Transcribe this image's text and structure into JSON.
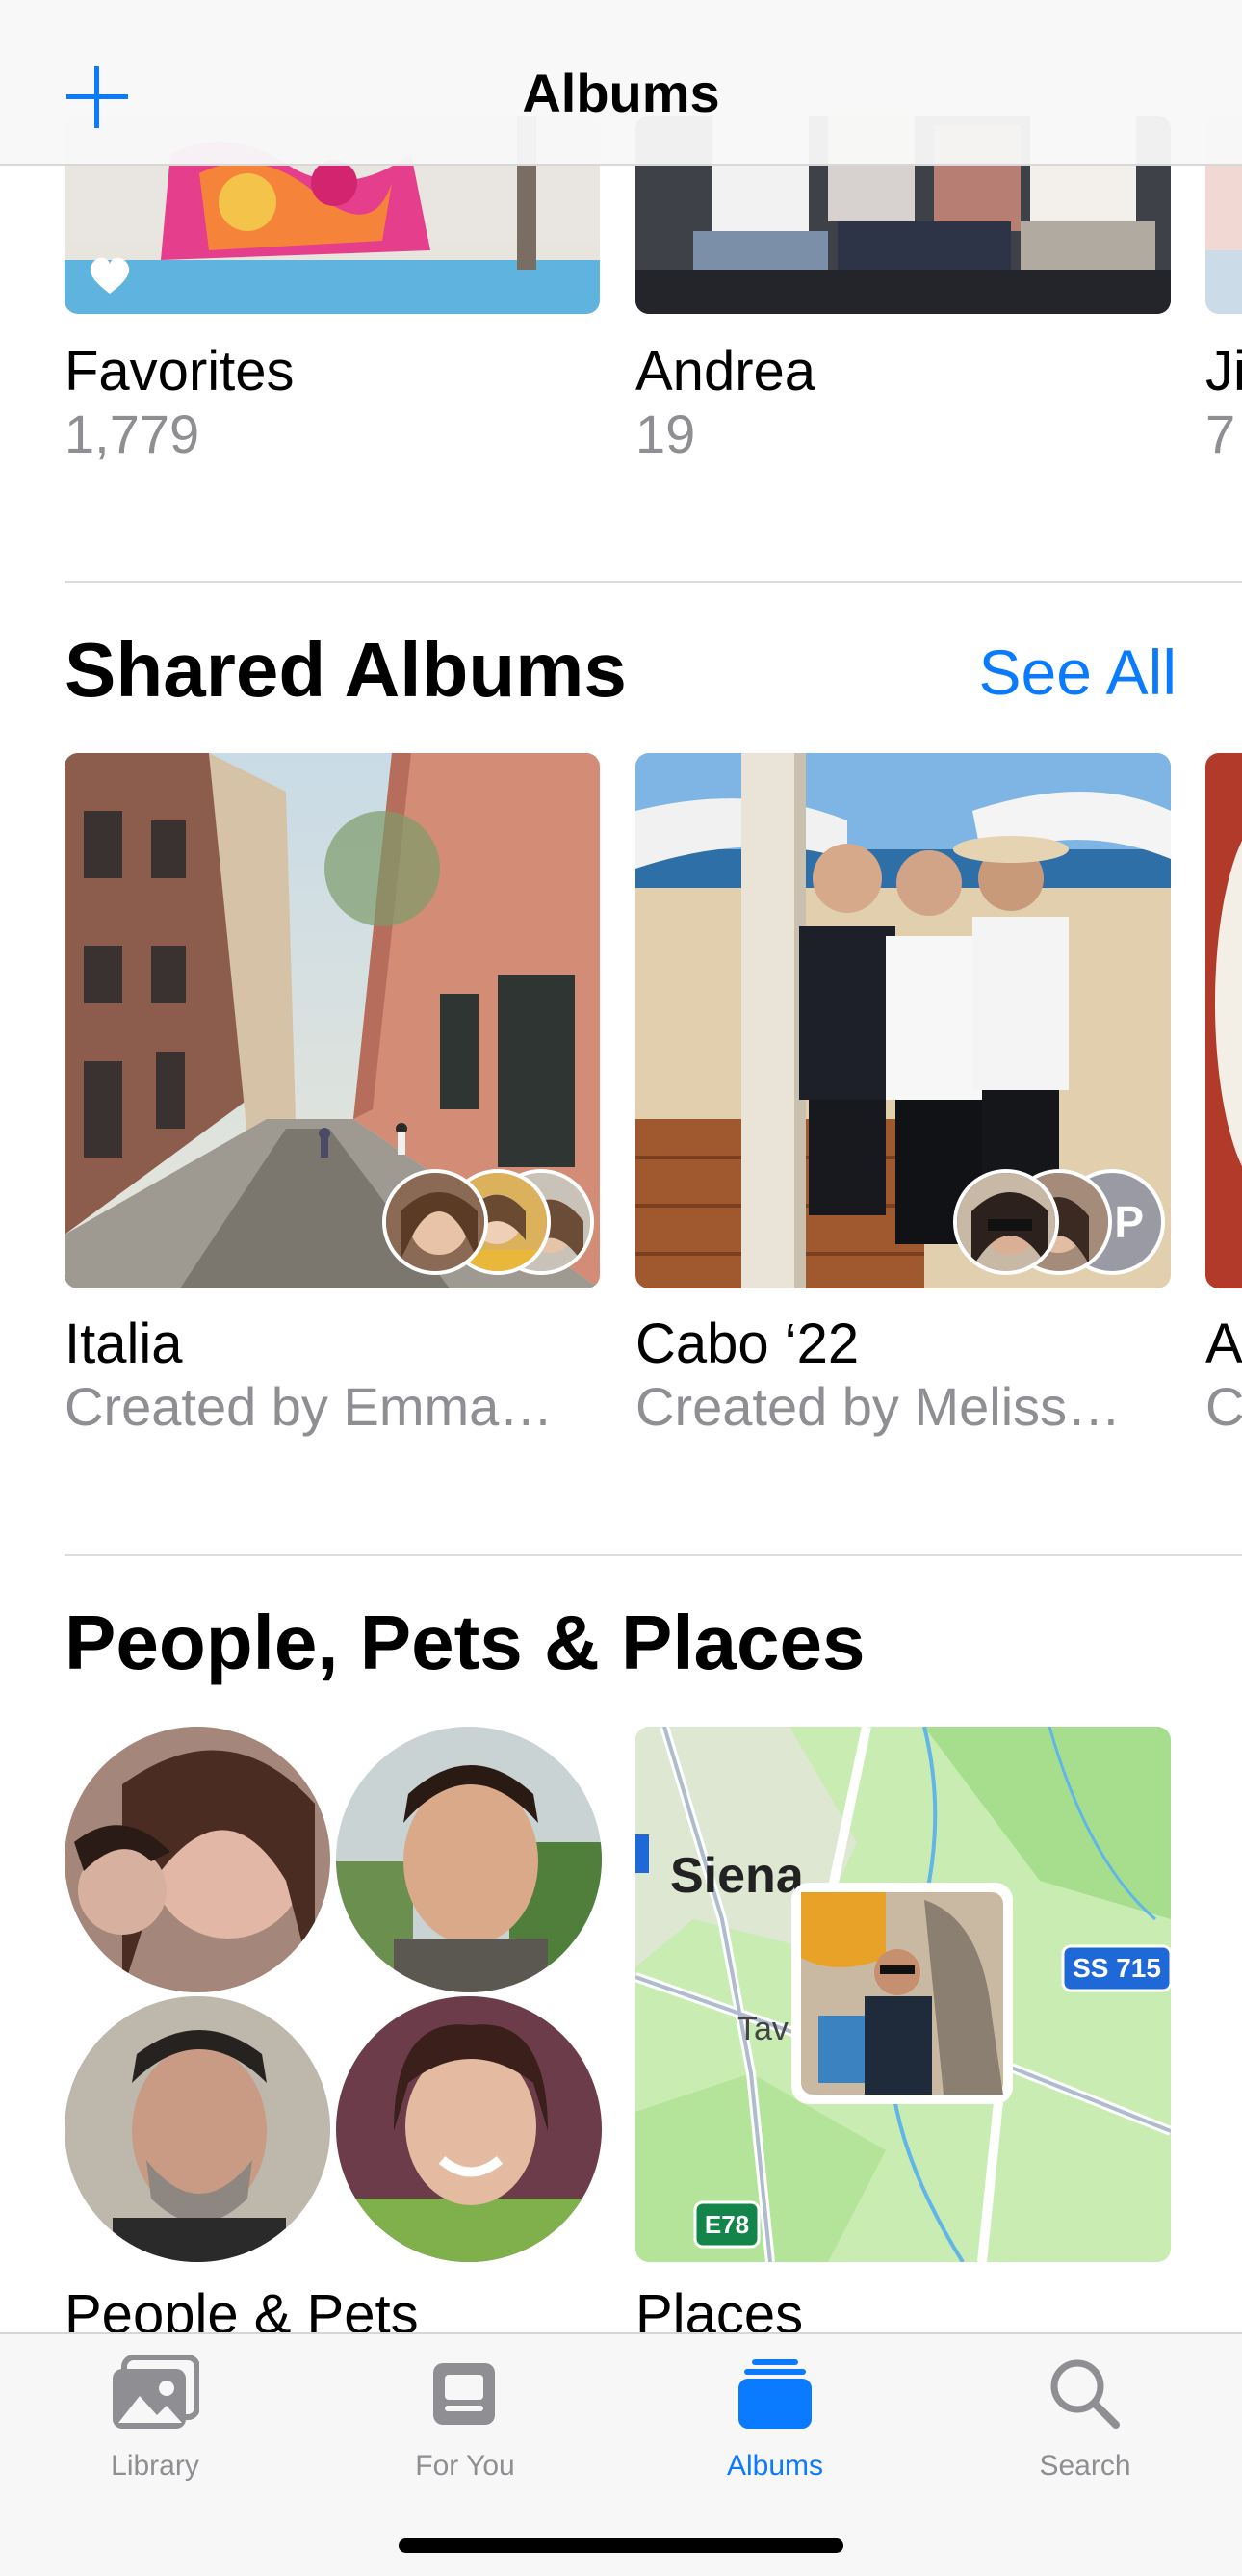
{
  "header": {
    "title": "Albums",
    "add_icon": "plus-icon"
  },
  "my_albums": [
    {
      "title": "Favorites",
      "count": "1,779"
    },
    {
      "title": "Andrea",
      "count": "19"
    },
    {
      "title": "Ji",
      "count": "7"
    }
  ],
  "shared": {
    "title": "Shared Albums",
    "see_all": "See All",
    "albums": [
      {
        "title": "Italia",
        "subtitle": "Created by Emma…"
      },
      {
        "title": "Cabo ‘22",
        "subtitle": "Created by Meliss…",
        "avatar_initial": "P"
      },
      {
        "title": "A",
        "subtitle": "C"
      }
    ]
  },
  "people_places": {
    "title": "People, Pets & Places",
    "people_label": "People & Pets",
    "places_label": "Places",
    "map": {
      "city": "Siena",
      "town": "Tav",
      "road1": "SS 715",
      "road2": "E78",
      "road3": ""
    }
  },
  "tabbar": {
    "accent": "#0a7aff",
    "inactive": "#8e8e93",
    "tabs": [
      {
        "label": "Library",
        "icon": "photos-icon",
        "active": false
      },
      {
        "label": "For You",
        "icon": "for-you-icon",
        "active": false
      },
      {
        "label": "Albums",
        "icon": "albums-icon",
        "active": true
      },
      {
        "label": "Search",
        "icon": "search-icon",
        "active": false
      }
    ]
  }
}
